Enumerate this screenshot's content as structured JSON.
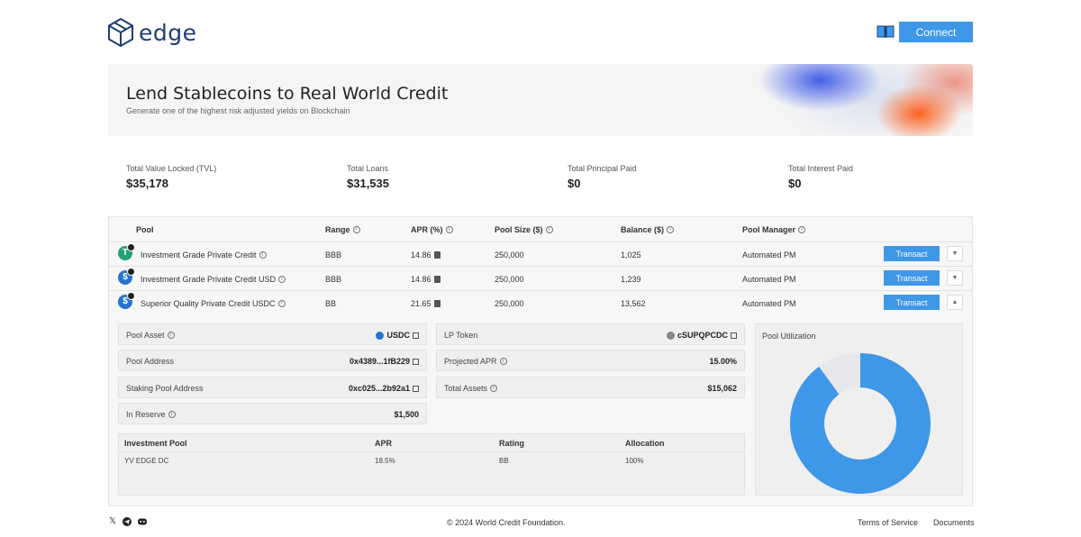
{
  "header": {
    "logo_text": "edge",
    "connect_label": "Connect",
    "book_icon": "book-icon"
  },
  "hero": {
    "title": "Lend Stablecoins to Real World Credit",
    "subtitle": "Generate one of the highest risk adjusted yields on Blockchain"
  },
  "stats": [
    {
      "label": "Total Value Locked (TVL)",
      "value": "$35,178"
    },
    {
      "label": "Total Loans",
      "value": "$31,535"
    },
    {
      "label": "Total Principal Paid",
      "value": "$0"
    },
    {
      "label": "Total Interest Paid",
      "value": "$0"
    }
  ],
  "table": {
    "headers": {
      "pool": "Pool",
      "range": "Range",
      "apr": "APR (%)",
      "pool_size": "Pool Size ($)",
      "balance": "Balance ($)",
      "manager": "Pool Manager"
    },
    "rows": [
      {
        "name": "Investment Grade Private Credit",
        "range": "BBB",
        "apr": "14.86",
        "pool_size": "250,000",
        "balance": "1,025",
        "manager": "Automated PM",
        "action": "Transact",
        "coin": "T",
        "coin_color": "#26a17b",
        "expanded": false
      },
      {
        "name": "Investment Grade Private Credit USD",
        "range": "BBB",
        "apr": "14.86",
        "pool_size": "250,000",
        "balance": "1,239",
        "manager": "Automated PM",
        "action": "Transact",
        "coin": "$",
        "coin_color": "#2775ca",
        "expanded": false
      },
      {
        "name": "Superior Quality Private Credit USDC",
        "range": "BB",
        "apr": "21.65",
        "pool_size": "250,000",
        "balance": "13,562",
        "manager": "Automated PM",
        "action": "Transact",
        "coin": "$",
        "coin_color": "#2775ca",
        "expanded": true
      }
    ]
  },
  "detail": {
    "pool_asset": {
      "label": "Pool Asset",
      "value": "USDC"
    },
    "pool_address": {
      "label": "Pool Address",
      "value": "0x4389...1fB229"
    },
    "staking_pool_address": {
      "label": "Staking Pool Address",
      "value": "0xc025...2b92a1"
    },
    "in_reserve": {
      "label": "In Reserve",
      "value": "$1,500"
    },
    "lp_token": {
      "label": "LP Token",
      "value": "cSUPQPCDC"
    },
    "projected_apr": {
      "label": "Projected APR",
      "value": "15.00%"
    },
    "total_assets": {
      "label": "Total Assets",
      "value": "$15,062"
    },
    "investment_table": {
      "headers": [
        "Investment Pool",
        "APR",
        "Rating",
        "Allocation"
      ],
      "rows": [
        [
          "YV EDGE DC",
          "18.5%",
          "BB",
          "100%"
        ]
      ]
    },
    "utilization": {
      "label": "Pool Utilization",
      "utilized_fraction": 0.9,
      "utilized_color": "#3f97e8",
      "remaining_color": "#e6e8ec"
    }
  },
  "footer": {
    "copyright": "© 2024 World Credit Foundation.",
    "terms": "Terms of Service",
    "docs": "Documents",
    "social_icons": [
      "x-icon",
      "telegram-icon",
      "discord-icon"
    ]
  }
}
